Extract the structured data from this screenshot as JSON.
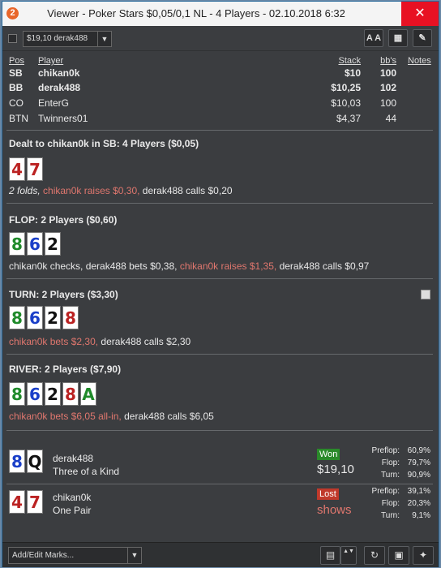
{
  "titlebar": {
    "title": "Viewer - Poker Stars $0,05/0,1 NL - 4 Players - 02.10.2018 6:32",
    "app_badge": "2",
    "close_glyph": "✕"
  },
  "toolbar": {
    "hand_select": "$19,10 derak488",
    "font_btn": "A A",
    "grid_btn": "▦",
    "edit_btn": "✎"
  },
  "players": {
    "headers": {
      "pos": "Pos",
      "player": "Player",
      "stack": "Stack",
      "bbs": "bb's",
      "notes": "Notes"
    },
    "rows": [
      {
        "pos": "SB",
        "name": "chikan0k",
        "stack": "$10",
        "bbs": "100"
      },
      {
        "pos": "BB",
        "name": "derak488",
        "stack": "$10,25",
        "bbs": "102"
      },
      {
        "pos": "CO",
        "name": "EnterG",
        "stack": "$10,03",
        "bbs": "100"
      },
      {
        "pos": "BTN",
        "name": "Twinners01",
        "stack": "$4,37",
        "bbs": "44"
      }
    ]
  },
  "preflop": {
    "title": "Dealt to chikan0k in SB: 4 Players ($0,05)",
    "cards": [
      {
        "rank": "4",
        "suit": "hearts"
      },
      {
        "rank": "7",
        "suit": "hearts"
      }
    ],
    "a1": "2 folds,",
    "a2": "chikan0k raises $0,30,",
    "a3": "derak488 calls $0,20"
  },
  "flop": {
    "title": "FLOP: 2 Players ($0,60)",
    "cards": [
      {
        "rank": "8",
        "suit": "clubs"
      },
      {
        "rank": "6",
        "suit": "diamonds"
      },
      {
        "rank": "2",
        "suit": "spades"
      }
    ],
    "a1": "chikan0k checks, derak488 bets $0,38,",
    "a2": "chikan0k raises $1,35,",
    "a3": "derak488 calls $0,97"
  },
  "turn": {
    "title": "TURN: 2 Players ($3,30)",
    "cards": [
      {
        "rank": "8",
        "suit": "clubs"
      },
      {
        "rank": "6",
        "suit": "diamonds"
      },
      {
        "rank": "2",
        "suit": "spades"
      },
      {
        "rank": "8",
        "suit": "hearts"
      }
    ],
    "a1": "chikan0k bets $2,30,",
    "a2": "derak488 calls $2,30"
  },
  "river": {
    "title": "RIVER: 2 Players ($7,90)",
    "cards": [
      {
        "rank": "8",
        "suit": "clubs"
      },
      {
        "rank": "6",
        "suit": "diamonds"
      },
      {
        "rank": "2",
        "suit": "spades"
      },
      {
        "rank": "8",
        "suit": "hearts"
      },
      {
        "rank": "A",
        "suit": "clubs"
      }
    ],
    "a1": "chikan0k bets $6,05 all-in,",
    "a2": "derak488 calls $6,05"
  },
  "showdown": [
    {
      "name": "derak488",
      "hand": "Three of a Kind",
      "cards": [
        {
          "rank": "8",
          "suit": "diamonds"
        },
        {
          "rank": "Q",
          "suit": "spades"
        }
      ],
      "result": "Won",
      "amount": "$19,10",
      "stats": [
        {
          "label": "Preflop:",
          "value": "60,9%"
        },
        {
          "label": "Flop:",
          "value": "79,7%"
        },
        {
          "label": "Turn:",
          "value": "90,9%"
        }
      ]
    },
    {
      "name": "chikan0k",
      "hand": "One Pair",
      "cards": [
        {
          "rank": "4",
          "suit": "hearts"
        },
        {
          "rank": "7",
          "suit": "hearts"
        }
      ],
      "result": "Lost",
      "amount": "shows",
      "stats": [
        {
          "label": "Preflop:",
          "value": "39,1%"
        },
        {
          "label": "Flop:",
          "value": "20,3%"
        },
        {
          "label": "Turn:",
          "value": "9,1%"
        }
      ]
    }
  ],
  "footer": {
    "marks_label": "Add/Edit Marks...",
    "calc_glyph": "▤",
    "updown_glyph": "▲▼",
    "refresh_glyph": "↻",
    "save_glyph": "▣",
    "twitter_glyph": "✦"
  },
  "colors": {
    "hero": "#e0776e",
    "won": "#2a8a2a",
    "lost": "#c0392b",
    "hearts": "#b22222",
    "diamonds": "#1a3fc8",
    "clubs": "#1f8a2a",
    "spades": "#111111"
  }
}
